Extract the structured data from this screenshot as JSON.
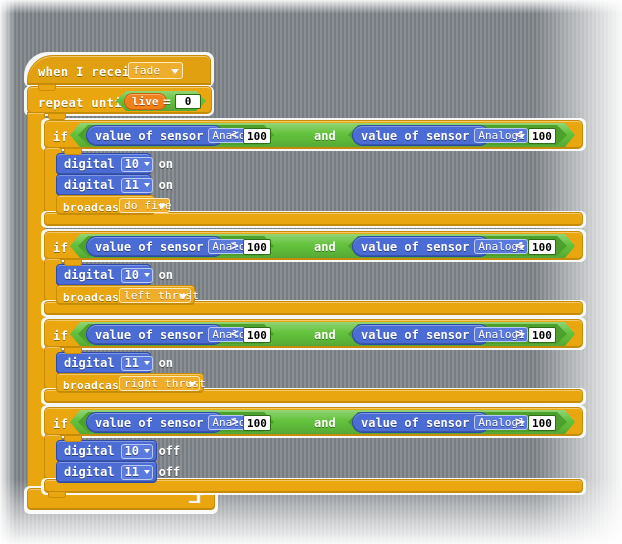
{
  "editor": {
    "name": "scratch-block-canvas",
    "background": "#7d8388"
  },
  "colors": {
    "control": "#e9a60f",
    "sensor_blue": "#4a6cd4",
    "operator_green": "#63c23c",
    "variable_orange": "#f0801a",
    "text": "#ffffff"
  },
  "script": {
    "hat": {
      "label": "when I receive",
      "dropdown": "fade"
    },
    "loop": {
      "label": "repeat until",
      "condition": {
        "variable": "live",
        "operator": "=",
        "value": "0"
      }
    },
    "if_blocks": [
      {
        "label": "if",
        "condition": {
          "left": {
            "label": "value of sensor",
            "pin": "Analog0",
            "operator": "<",
            "value": "100"
          },
          "joiner": "and",
          "right": {
            "label": "value of sensor",
            "pin": "Analog1",
            "operator": "<",
            "value": "100"
          }
        },
        "body": [
          {
            "type": "digital",
            "label": "digital",
            "pin": "10",
            "state": "on"
          },
          {
            "type": "digital",
            "label": "digital",
            "pin": "11",
            "state": "on"
          },
          {
            "type": "broadcast",
            "label": "broadcast",
            "message": "do fire"
          }
        ]
      },
      {
        "label": "if",
        "condition": {
          "left": {
            "label": "value of sensor",
            "pin": "Analog0",
            "operator": ">",
            "value": "100"
          },
          "joiner": "and",
          "right": {
            "label": "value of sensor",
            "pin": "Analog1",
            "operator": "<",
            "value": "100"
          }
        },
        "body": [
          {
            "type": "digital",
            "label": "digital",
            "pin": "10",
            "state": "on"
          },
          {
            "type": "broadcast",
            "label": "broadcast",
            "message": "left thrust"
          }
        ]
      },
      {
        "label": "if",
        "condition": {
          "left": {
            "label": "value of sensor",
            "pin": "Analog0",
            "operator": "<",
            "value": "100"
          },
          "joiner": "and",
          "right": {
            "label": "value of sensor",
            "pin": "Analog1",
            "operator": ">",
            "value": "100"
          }
        },
        "body": [
          {
            "type": "digital",
            "label": "digital",
            "pin": "11",
            "state": "on"
          },
          {
            "type": "broadcast",
            "label": "broadcast",
            "message": "right thrust"
          }
        ]
      },
      {
        "label": "if",
        "condition": {
          "left": {
            "label": "value of sensor",
            "pin": "Analog0",
            "operator": ">",
            "value": "100"
          },
          "joiner": "and",
          "right": {
            "label": "value of sensor",
            "pin": "Analog1",
            "operator": ">",
            "value": "100"
          }
        },
        "body": [
          {
            "type": "digital",
            "label": "digital",
            "pin": "10",
            "state": "off"
          },
          {
            "type": "digital",
            "label": "digital",
            "pin": "11",
            "state": "off"
          }
        ]
      }
    ],
    "loop_arrow_icon": "loop-arrow-icon"
  }
}
